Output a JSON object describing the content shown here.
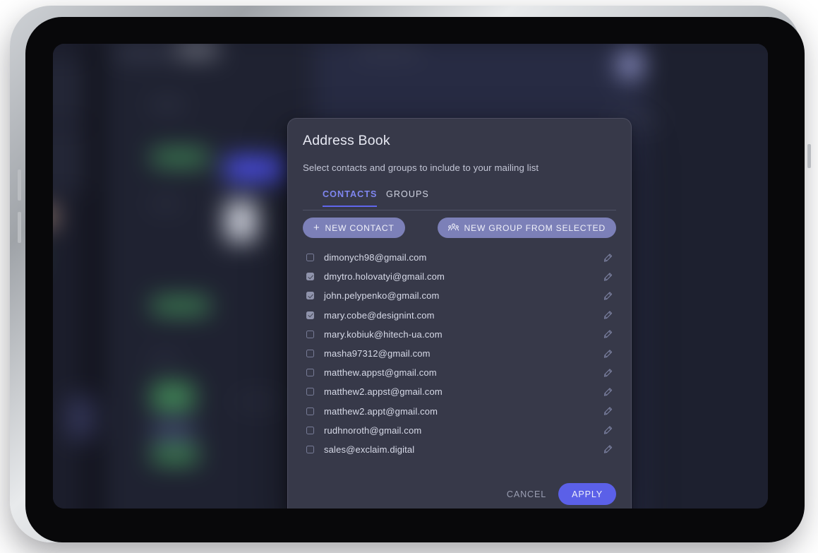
{
  "device": {
    "type": "tablet-mockup"
  },
  "dialog": {
    "title": "Address Book",
    "subtitle": "Select contacts and groups to include to your mailing list",
    "tabs": [
      {
        "label": "CONTACTS",
        "active": true
      },
      {
        "label": "GROUPS",
        "active": false
      }
    ],
    "actions": {
      "new_contact_label": "NEW CONTACT",
      "new_contact_icon": "plus-icon",
      "new_group_label": "NEW GROUP FROM SELECTED",
      "new_group_icon": "group-people-icon"
    },
    "contacts": [
      {
        "email": "dimonych98@gmail.com",
        "checked": false
      },
      {
        "email": "dmytro.holovatyi@gmail.com",
        "checked": true
      },
      {
        "email": "john.pelypenko@gmail.com",
        "checked": true
      },
      {
        "email": "mary.cobe@designint.com",
        "checked": true
      },
      {
        "email": "mary.kobiuk@hitech-ua.com",
        "checked": false
      },
      {
        "email": "masha97312@gmail.com",
        "checked": false
      },
      {
        "email": "matthew.appst@gmail.com",
        "checked": false
      },
      {
        "email": "matthew2.appst@gmail.com",
        "checked": false
      },
      {
        "email": "matthew2.appt@gmail.com",
        "checked": false
      },
      {
        "email": "rudhnoroth@gmail.com",
        "checked": false
      },
      {
        "email": "sales@exclaim.digital",
        "checked": false
      }
    ],
    "row_edit_icon": "pencil-icon",
    "footer": {
      "cancel_label": "CANCEL",
      "apply_label": "APPLY"
    }
  },
  "colors": {
    "dialog_surface": "#373949",
    "accent": "#5b60e8",
    "tab_active": "#7f86f0",
    "pill_muted": "#7c80b8",
    "checkbox_on": "#8f93ab",
    "text_primary": "#e6e8f2",
    "text_secondary": "#c3c6d6"
  }
}
